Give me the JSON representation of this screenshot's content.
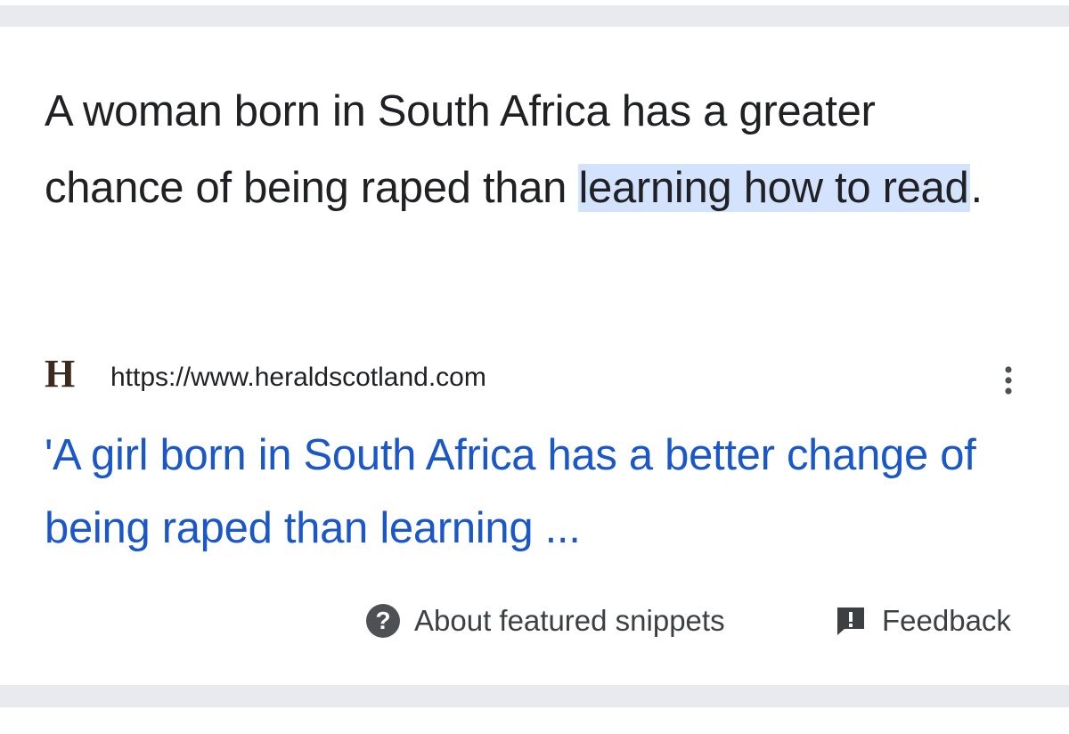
{
  "snippet": {
    "text_before": "A woman born in South Africa has a greater chance of being raped than ",
    "highlight": "learning how to read",
    "text_after": "."
  },
  "source": {
    "logo_letter": "H",
    "url": "https://www.heraldscotland.com",
    "more_icon": "more-vert-icon"
  },
  "result": {
    "title": "'A girl born in South Africa has a better change of being raped than learning ..."
  },
  "footer": {
    "help_icon_glyph": "?",
    "about_label": "About featured snippets",
    "feedback_label": "Feedback"
  },
  "colors": {
    "link": "#1a57c9",
    "highlight": "#d3e3fd",
    "divider": "#e8eaed",
    "text": "#202124"
  }
}
